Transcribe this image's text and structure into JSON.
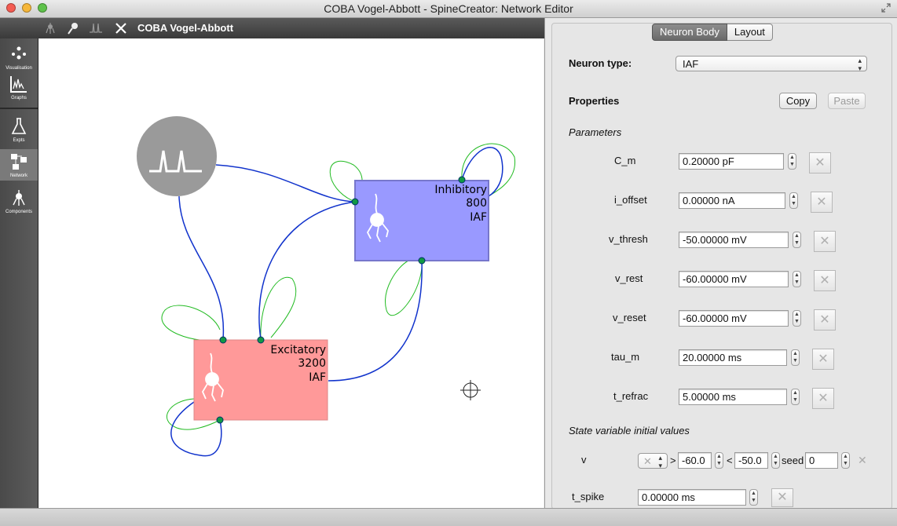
{
  "window": {
    "title": "COBA Vogel-Abbott - SpineCreator: Network Editor"
  },
  "toolbar": {
    "title": "COBA Vogel-Abbott"
  },
  "sidebar": {
    "items": [
      {
        "label": "Visualisation"
      },
      {
        "label": "Graphs"
      },
      {
        "label": "Expts"
      },
      {
        "label": "Network"
      },
      {
        "label": "Components"
      }
    ]
  },
  "network": {
    "inhibitory": {
      "name": "Inhibitory",
      "size": "800",
      "type": "IAF",
      "color": "#9999ff"
    },
    "excitatory": {
      "name": "Excitatory",
      "size": "3200",
      "type": "IAF",
      "color": "#ff9999"
    },
    "connection_color": "#1133cc",
    "self_loop_color": "#22bb22"
  },
  "panel": {
    "tabs": [
      "Neuron Body",
      "Layout"
    ],
    "neuron_type_label": "Neuron type:",
    "neuron_type_value": "IAF",
    "properties_label": "Properties",
    "copy_label": "Copy",
    "paste_label": "Paste",
    "parameters_label": "Parameters",
    "parameters": [
      {
        "name": "C_m",
        "value": "0.20000 pF"
      },
      {
        "name": "i_offset",
        "value": "0.00000 nA"
      },
      {
        "name": "v_thresh",
        "value": "-50.00000 mV"
      },
      {
        "name": "v_rest",
        "value": "-60.00000 mV"
      },
      {
        "name": "v_reset",
        "value": "-60.00000 mV"
      },
      {
        "name": "tau_m",
        "value": "20.00000 ms"
      },
      {
        "name": "t_refrac",
        "value": "5.00000 ms"
      }
    ],
    "state_label": "State variable initial values",
    "state_v": {
      "name": "v",
      "gt": ">",
      "min": "-60.0",
      "lt": "<",
      "max": "-50.0",
      "seed_label": "seed",
      "seed": "0"
    },
    "state_tspike": {
      "name": "t_spike",
      "value": "0.00000 ms"
    }
  }
}
